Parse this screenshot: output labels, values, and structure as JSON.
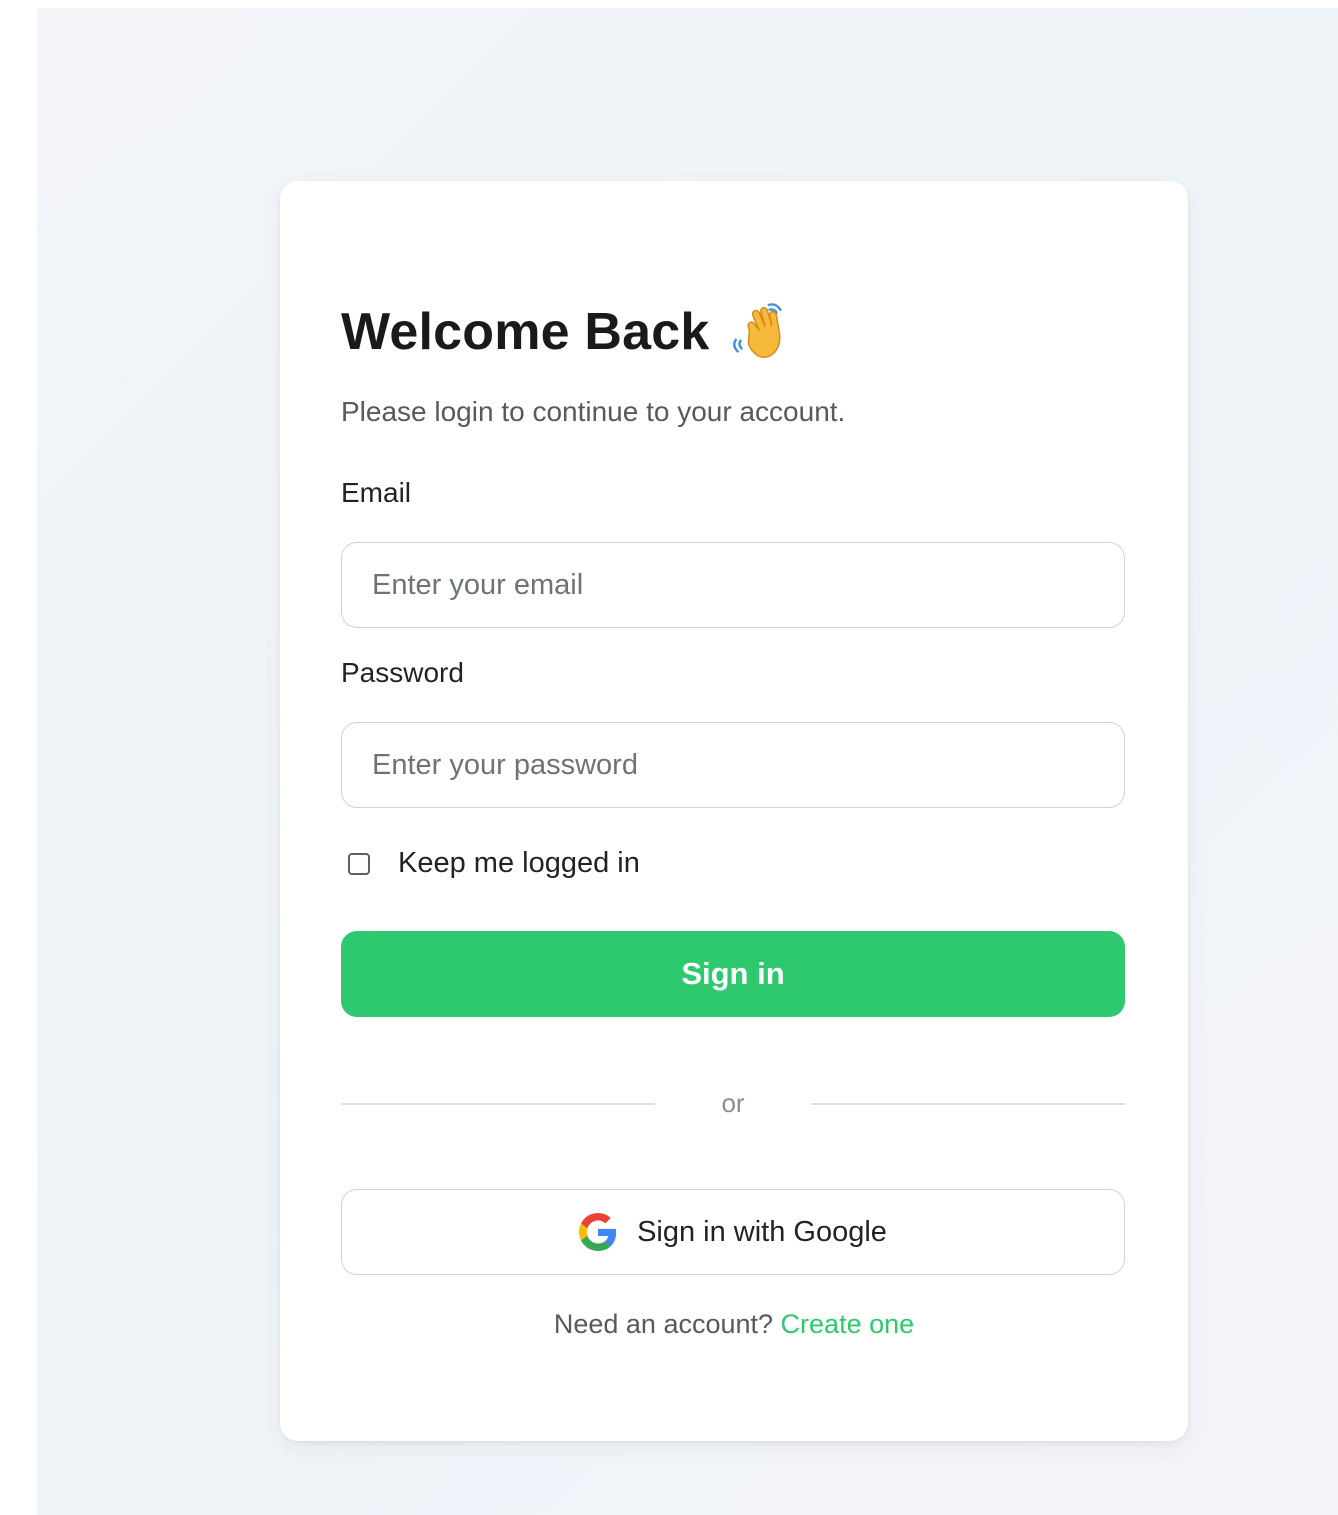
{
  "login": {
    "title": "Welcome Back",
    "subtitle": "Please login to continue to your account.",
    "email_label": "Email",
    "email_placeholder": "Enter your email",
    "password_label": "Password",
    "password_placeholder": "Enter your password",
    "remember_label": "Keep me logged in",
    "remember_checked": false,
    "signin_label": "Sign in",
    "divider_text": "or",
    "google_label": "Sign in with Google",
    "footer_text": "Need an account?",
    "footer_link": "Create one"
  },
  "icons": {
    "title_icon": "waving-hand-icon",
    "google_icon": "google-g-icon"
  },
  "colors": {
    "accent": "#2ec96e",
    "background": "#f0f3f8",
    "card": "#ffffff",
    "title": "#1a1a1a",
    "muted": "#555a60"
  }
}
